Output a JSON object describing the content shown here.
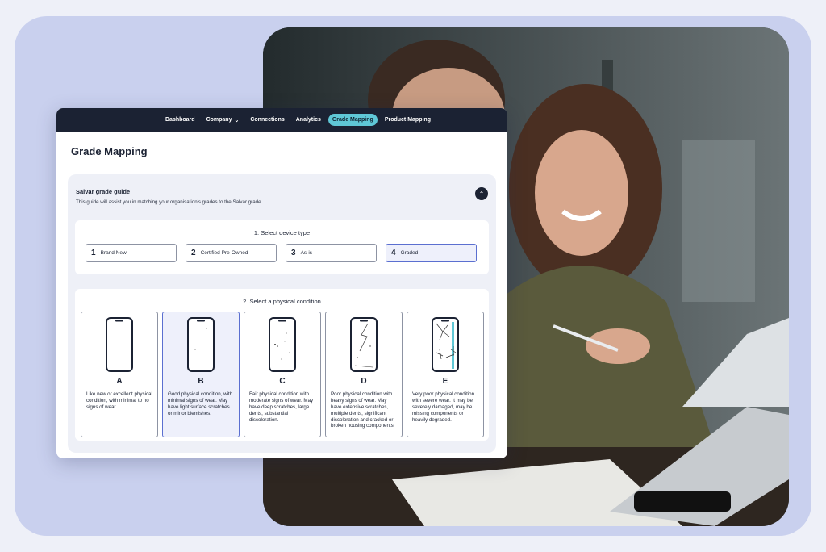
{
  "nav": {
    "items": [
      {
        "label": "Dashboard"
      },
      {
        "label": "Company",
        "has_dropdown": true,
        "icon": "chevron-down-icon"
      },
      {
        "label": "Connections"
      },
      {
        "label": "Analytics"
      },
      {
        "label": "Grade Mapping",
        "active": true
      },
      {
        "label": "Product Mapping"
      }
    ]
  },
  "page": {
    "title": "Grade Mapping"
  },
  "guide": {
    "title": "Salvar grade guide",
    "subtitle": "This guide will assist you in matching your organisation's grades to the Salvar grade.",
    "collapse_icon": "chevron-up-icon"
  },
  "device_type": {
    "heading": "1. Select device type",
    "options": [
      {
        "num": "1",
        "label": "Brand New"
      },
      {
        "num": "2",
        "label": "Certified Pre-Owned"
      },
      {
        "num": "3",
        "label": "As-is"
      },
      {
        "num": "4",
        "label": "Graded"
      }
    ],
    "selected": "Graded"
  },
  "condition": {
    "heading": "2. Select a physical condition",
    "options": [
      {
        "letter": "A",
        "desc": "Like new or excellent physical condition, with minimal to no signs of wear."
      },
      {
        "letter": "B",
        "desc": "Good physical condition, with minimal signs of wear. May have light surface scratches or minor blemishes."
      },
      {
        "letter": "C",
        "desc": "Fair physical condition with moderate signs of wear. May have deep scratches, large dents, substantial discoloration."
      },
      {
        "letter": "D",
        "desc": "Poor physical condition with heavy signs of wear. May have extensive scratches, multiple dents, significant discoloration and cracked or broken housing components."
      },
      {
        "letter": "E",
        "desc": "Very poor physical condition with severe wear. It may be severely damaged, may be missing components or heavily degraded."
      }
    ],
    "selected": "B"
  },
  "colors": {
    "nav_bg": "#1b2233",
    "active_pill": "#5fc7d6",
    "selected_border": "#5b6fd0",
    "frame": "#c9d0ee"
  }
}
